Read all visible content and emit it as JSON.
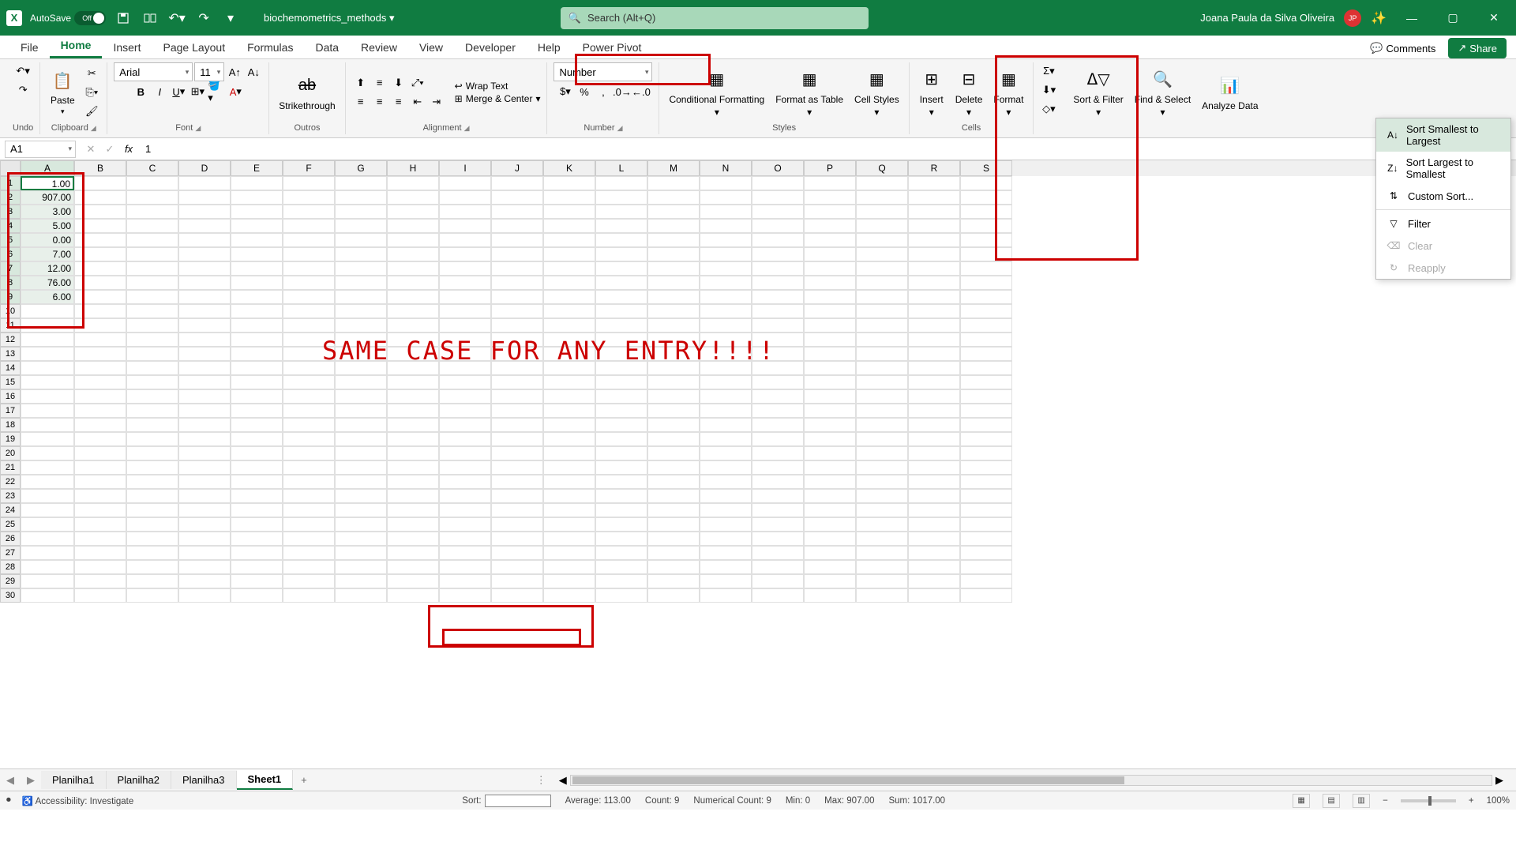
{
  "titlebar": {
    "autosave_label": "AutoSave",
    "autosave_state": "Off",
    "filename": "biochemometrics_methods",
    "search_placeholder": "Search (Alt+Q)",
    "username": "Joana Paula da Silva Oliveira",
    "user_initials": "JP"
  },
  "tabs": {
    "file": "File",
    "home": "Home",
    "insert": "Insert",
    "page_layout": "Page Layout",
    "formulas": "Formulas",
    "data": "Data",
    "review": "Review",
    "view": "View",
    "developer": "Developer",
    "help": "Help",
    "power_pivot": "Power Pivot",
    "comments": "Comments",
    "share": "Share"
  },
  "ribbon": {
    "undo": "Undo",
    "paste": "Paste",
    "clipboard": "Clipboard",
    "font_name": "Arial",
    "font_size": "11",
    "strikethrough": "Strikethrough",
    "font": "Font",
    "outros": "Outros",
    "wrap": "Wrap Text",
    "merge": "Merge & Center",
    "alignment": "Alignment",
    "num_format": "Number",
    "number": "Number",
    "cond_fmt": "Conditional Formatting",
    "fmt_table": "Format as Table",
    "cell_styles": "Cell Styles",
    "styles": "Styles",
    "insert_btn": "Insert",
    "delete_btn": "Delete",
    "format_btn": "Format",
    "cells": "Cells",
    "sort_filter": "Sort & Filter",
    "find_select": "Find & Select",
    "analyze": "Analyze Data"
  },
  "sort_menu": {
    "asc": "Sort Smallest to Largest",
    "desc": "Sort Largest to Smallest",
    "custom": "Custom Sort...",
    "filter": "Filter",
    "clear": "Clear",
    "reapply": "Reapply"
  },
  "formula_bar": {
    "cell_ref": "A1",
    "value": "1"
  },
  "columns": [
    "A",
    "B",
    "C",
    "D",
    "E",
    "F",
    "G",
    "H",
    "I",
    "J",
    "K",
    "L",
    "M",
    "N",
    "O",
    "P",
    "Q",
    "R",
    "S"
  ],
  "cell_data": [
    "1.00",
    "907.00",
    "3.00",
    "5.00",
    "0.00",
    "7.00",
    "12.00",
    "76.00",
    "6.00"
  ],
  "overlay_text": "SAME CASE FOR ANY ENTRY!!!!",
  "sheets": {
    "s1": "Planilha1",
    "s2": "Planilha2",
    "s3": "Planilha3",
    "s4": "Sheet1"
  },
  "statusbar": {
    "access": "Accessibility: Investigate",
    "sort_label": "Sort:",
    "avg": "Average: 113.00",
    "count": "Count: 9",
    "num_count": "Numerical Count: 9",
    "min": "Min: 0",
    "max": "Max: 907.00",
    "sum": "Sum: 1017.00",
    "zoom": "100%"
  }
}
